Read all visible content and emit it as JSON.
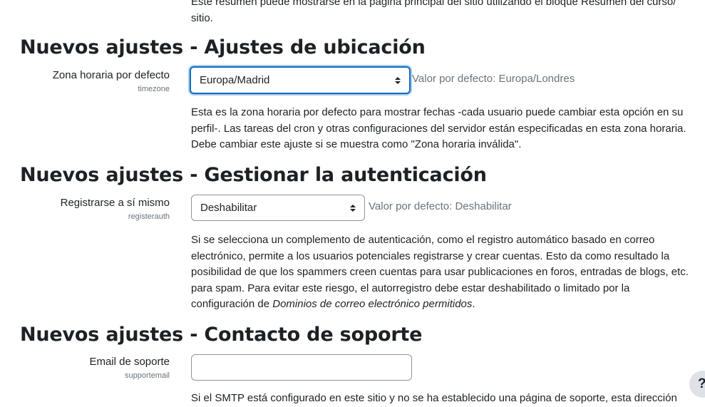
{
  "course_summary": {
    "description_line1": "Este resumen puede mostrarse en la página principal del sitio utilizando el bloque Resumen del curso/",
    "description_line2": "sitio."
  },
  "location": {
    "heading": "Nuevos ajustes - Ajustes de ubicación",
    "label": "Zona horaria por defecto",
    "sublabel": "timezone",
    "selected": "Europa/Madrid",
    "default_text": "Valor por defecto: Europa/Londres",
    "description": "Esta es la zona horaria por defecto para mostrar fechas -cada usuario puede cambiar esta opción en su perfil-. Las tareas del cron y otras configuraciones del servidor están especificadas en esta zona horaria. Debe cambiar este ajuste si se muestra como \"Zona horaria inválida\"."
  },
  "auth": {
    "heading": "Nuevos ajustes - Gestionar la autenticación",
    "label": "Registrarse a sí mismo",
    "sublabel": "registerauth",
    "selected": "Deshabilitar",
    "default_text": "Valor por defecto: Deshabilitar",
    "description_main": "Si se selecciona un complemento de autenticación, como el registro automático basado en correo electrónico, permite a los usuarios potenciales registrarse y crear cuentas. Esto da como resultado la posibilidad de que los spammers creen cuentas para usar publicaciones en foros, entradas de blogs, etc. para spam. Para evitar este riesgo, el autorregistro debe estar deshabilitado o limitado por la configuración de ",
    "description_emph": "Dominios de correo electrónico permitidos",
    "description_end": "."
  },
  "support": {
    "heading": "Nuevos ajustes - Contacto de soporte",
    "label": "Email de soporte",
    "sublabel": "supportemail",
    "value": "",
    "description_partial": "Si el SMTP está configurado en este sitio y no se ha establecido una página de soporte, esta dirección"
  },
  "help_button": {
    "label": "?"
  },
  "icons": {
    "select_arrows": "select-arrows-icon"
  }
}
